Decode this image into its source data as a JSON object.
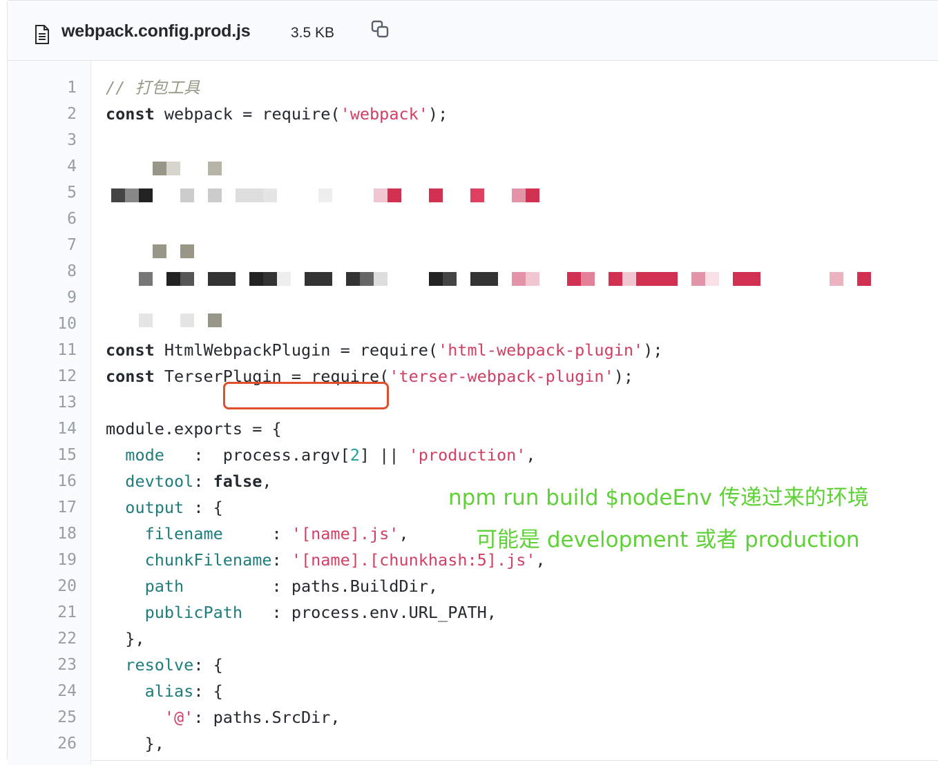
{
  "file": {
    "name": "webpack.config.prod.js",
    "size": "3.5 KB",
    "file_icon": "file-icon",
    "copy_icon": "copy-icon"
  },
  "lines": [
    {
      "n": "1",
      "tokens": [
        {
          "t": "// 打包工具",
          "c": "com"
        }
      ]
    },
    {
      "n": "2",
      "tokens": [
        {
          "t": "const",
          "c": "kw"
        },
        {
          "t": " webpack = require(",
          "c": ""
        },
        {
          "t": "'webpack'",
          "c": "str"
        },
        {
          "t": ");",
          "c": ""
        }
      ]
    },
    {
      "n": "3",
      "tokens": []
    },
    {
      "n": "4",
      "tokens": []
    },
    {
      "n": "5",
      "tokens": []
    },
    {
      "n": "6",
      "tokens": []
    },
    {
      "n": "7",
      "tokens": []
    },
    {
      "n": "8",
      "tokens": []
    },
    {
      "n": "9",
      "tokens": []
    },
    {
      "n": "10",
      "tokens": []
    },
    {
      "n": "11",
      "tokens": [
        {
          "t": "const",
          "c": "kw"
        },
        {
          "t": " HtmlWebpackPlugin = require(",
          "c": ""
        },
        {
          "t": "'html-webpack-plugin'",
          "c": "str"
        },
        {
          "t": ");",
          "c": ""
        }
      ]
    },
    {
      "n": "12",
      "tokens": [
        {
          "t": "const",
          "c": "kw"
        },
        {
          "t": " TerserPlugin = require(",
          "c": ""
        },
        {
          "t": "'terser-webpack-plugin'",
          "c": "str"
        },
        {
          "t": ");",
          "c": ""
        }
      ]
    },
    {
      "n": "13",
      "tokens": []
    },
    {
      "n": "14",
      "tokens": [
        {
          "t": "module.exports = {",
          "c": ""
        }
      ]
    },
    {
      "n": "15",
      "tokens": [
        {
          "t": "  ",
          "c": ""
        },
        {
          "t": "mode",
          "c": "prop"
        },
        {
          "t": "   :  process.argv[",
          "c": ""
        },
        {
          "t": "2",
          "c": "num"
        },
        {
          "t": "] || ",
          "c": ""
        },
        {
          "t": "'production'",
          "c": "str"
        },
        {
          "t": ",",
          "c": ""
        }
      ]
    },
    {
      "n": "16",
      "tokens": [
        {
          "t": "  ",
          "c": ""
        },
        {
          "t": "devtool",
          "c": "prop"
        },
        {
          "t": ": ",
          "c": ""
        },
        {
          "t": "false",
          "c": "kw"
        },
        {
          "t": ",",
          "c": ""
        }
      ]
    },
    {
      "n": "17",
      "tokens": [
        {
          "t": "  ",
          "c": ""
        },
        {
          "t": "output",
          "c": "prop"
        },
        {
          "t": " : {",
          "c": ""
        }
      ]
    },
    {
      "n": "18",
      "tokens": [
        {
          "t": "    ",
          "c": ""
        },
        {
          "t": "filename",
          "c": "prop"
        },
        {
          "t": "     : ",
          "c": ""
        },
        {
          "t": "'[name].js'",
          "c": "str"
        },
        {
          "t": ",",
          "c": ""
        }
      ]
    },
    {
      "n": "19",
      "tokens": [
        {
          "t": "    ",
          "c": ""
        },
        {
          "t": "chunkFilename",
          "c": "prop"
        },
        {
          "t": ": ",
          "c": ""
        },
        {
          "t": "'[name].[chunkhash:5].js'",
          "c": "str"
        },
        {
          "t": ",",
          "c": ""
        }
      ]
    },
    {
      "n": "20",
      "tokens": [
        {
          "t": "    ",
          "c": ""
        },
        {
          "t": "path",
          "c": "prop"
        },
        {
          "t": "         : paths.BuildDir,",
          "c": ""
        }
      ]
    },
    {
      "n": "21",
      "tokens": [
        {
          "t": "    ",
          "c": ""
        },
        {
          "t": "publicPath",
          "c": "prop"
        },
        {
          "t": "   : process.env.URL_PATH,",
          "c": ""
        }
      ]
    },
    {
      "n": "22",
      "tokens": [
        {
          "t": "  },",
          "c": ""
        }
      ]
    },
    {
      "n": "23",
      "tokens": [
        {
          "t": "  ",
          "c": ""
        },
        {
          "t": "resolve",
          "c": "prop"
        },
        {
          "t": ": {",
          "c": ""
        }
      ]
    },
    {
      "n": "24",
      "tokens": [
        {
          "t": "    ",
          "c": ""
        },
        {
          "t": "alias",
          "c": "prop"
        },
        {
          "t": ": {",
          "c": ""
        }
      ]
    },
    {
      "n": "25",
      "tokens": [
        {
          "t": "      ",
          "c": ""
        },
        {
          "t": "'@'",
          "c": "str"
        },
        {
          "t": ": paths.SrcDir,",
          "c": ""
        }
      ]
    },
    {
      "n": "26",
      "tokens": [
        {
          "t": "    },",
          "c": ""
        }
      ]
    }
  ],
  "annotations": {
    "line1": "npm run build $nodeEnv 传递过来的环境",
    "line2": "可能是 development 或者 production"
  },
  "colors": {
    "annotation": "#5ed136",
    "highlight_box": "#e04e2c",
    "string": "#d14063",
    "property": "#1f7c7c"
  }
}
